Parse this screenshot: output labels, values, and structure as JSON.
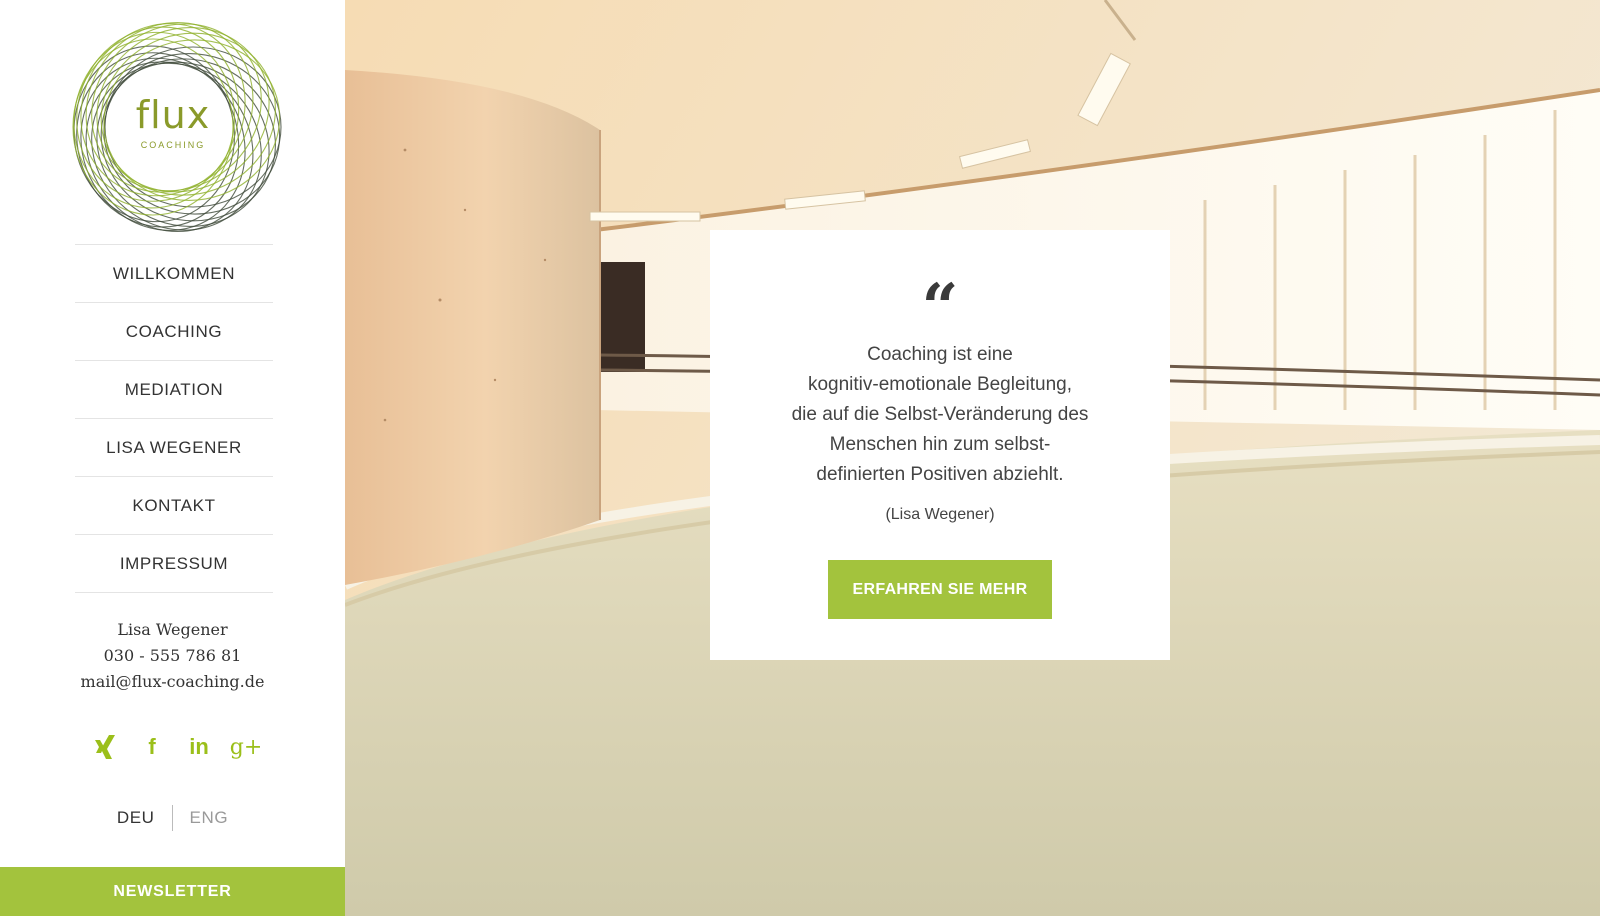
{
  "logo": {
    "name": "flux",
    "sub": "COACHING"
  },
  "nav": [
    {
      "label": "WILLKOMMEN"
    },
    {
      "label": "COACHING"
    },
    {
      "label": "MEDIATION"
    },
    {
      "label": "LISA WEGENER"
    },
    {
      "label": "KONTAKT"
    },
    {
      "label": "IMPRESSUM"
    }
  ],
  "contact": {
    "name": "Lisa Wegener",
    "phone": "030 - 555 786 81",
    "email": "mail@flux-coaching.de"
  },
  "social": {
    "icons": [
      "xing-icon",
      "facebook-icon",
      "linkedin-icon",
      "google-plus-icon"
    ],
    "xing": "✕",
    "facebook": "f",
    "linkedin": "in",
    "googleplus": "g+"
  },
  "language": {
    "deu": "DEU",
    "eng": "ENG"
  },
  "newsletter": {
    "label": "NEWSLETTER"
  },
  "quote": {
    "mark": "“",
    "lines": [
      "Coaching ist eine",
      "kognitiv-emotionale Begleitung,",
      "die auf die Selbst-Veränderung des",
      "Menschen hin zum selbst-",
      "definierten Positiven abziehlt."
    ],
    "author": "(Lisa Wegener)",
    "cta": "ERFAHREN SIE MEHR"
  },
  "colors": {
    "accent": "#a3c33d",
    "text": "#333333"
  }
}
